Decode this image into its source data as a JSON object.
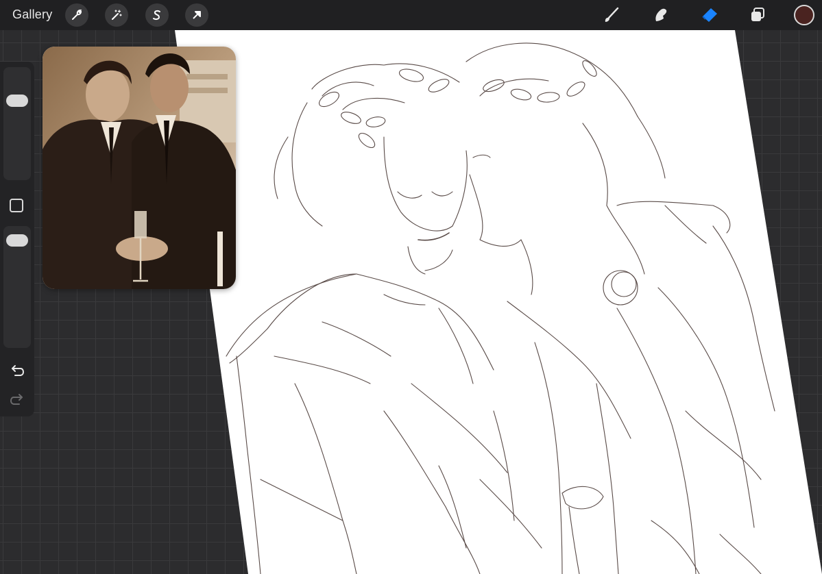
{
  "topbar": {
    "gallery_label": "Gallery",
    "left_tools": [
      {
        "name": "actions",
        "icon": "wrench-icon"
      },
      {
        "name": "adjustments",
        "icon": "magic-wand-icon"
      },
      {
        "name": "selection",
        "icon": "selection-s-icon"
      },
      {
        "name": "transform",
        "icon": "arrow-cursor-icon"
      }
    ],
    "right_tools": [
      {
        "name": "brush",
        "icon": "brush-icon",
        "active": false
      },
      {
        "name": "smudge",
        "icon": "smudge-finger-icon",
        "active": false
      },
      {
        "name": "eraser",
        "icon": "eraser-icon",
        "active": true
      },
      {
        "name": "layers",
        "icon": "layers-icon",
        "active": false
      }
    ],
    "current_color": "#4a2320",
    "active_tool_color": "#1a84ff"
  },
  "sidebar": {
    "size_slider_icon": "brush-size-slider",
    "modifier_icon": "square-modifier-icon",
    "opacity_slider_icon": "opacity-slider",
    "undo_icon": "undo-icon",
    "redo_icon": "redo-icon"
  },
  "reference": {
    "icon": "reference-photo",
    "tone": "sepia"
  },
  "canvas": {
    "paper_color": "#ffffff",
    "stroke_color": "#3b2a26"
  }
}
